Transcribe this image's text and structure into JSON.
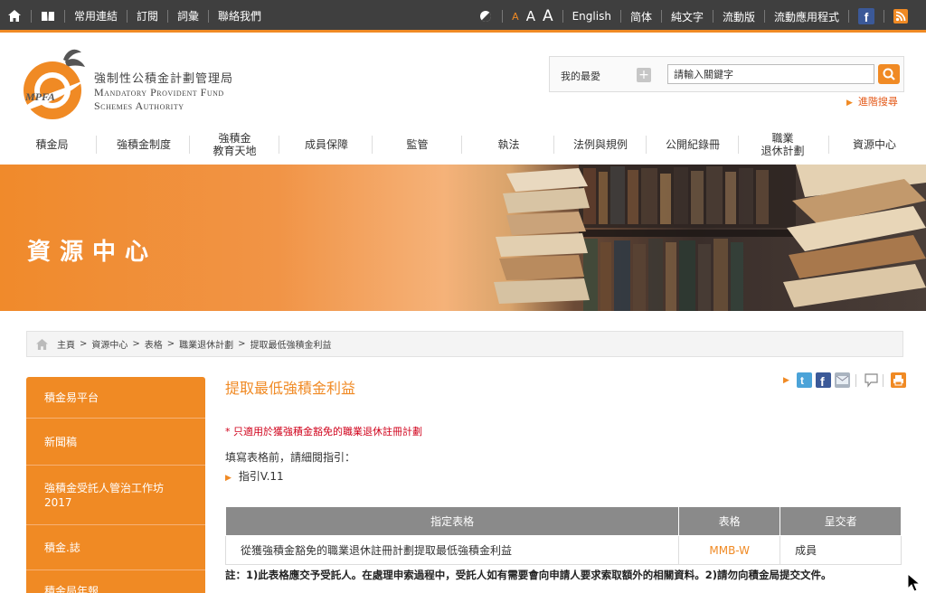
{
  "topbar": {
    "left_links": [
      "常用連結",
      "訂閱",
      "詞彙",
      "聯絡我們"
    ],
    "font_sizes": [
      "A",
      "A",
      "A"
    ],
    "right_links": [
      "English",
      "简体",
      "純文字",
      "流動版",
      "流動應用程式"
    ]
  },
  "logo": {
    "mark": "MPFA",
    "cn": "強制性公積金計劃管理局",
    "en_line1": "Mandatory Provident Fund",
    "en_line2": "Schemes Authority"
  },
  "search": {
    "favorites_label": "我的最愛",
    "input_value": "請輸入關鍵字",
    "advanced_label": "進階搜尋"
  },
  "nav": [
    "積金局",
    "強積金制度",
    "強積金\n教育天地",
    "成員保障",
    "監管",
    "執法",
    "法例與規例",
    "公開紀錄冊",
    "職業\n退休計劃",
    "資源中心"
  ],
  "banner": {
    "title": "資源中心"
  },
  "breadcrumb": [
    "主頁",
    "資源中心",
    "表格",
    "職業退休計劃",
    "提取最低強積金利益"
  ],
  "leftnav": [
    "積金易平台",
    "新聞稿",
    "強積金受託人管治工作坊\n2017",
    "積金.誌",
    "積金局年報"
  ],
  "content": {
    "title": "提取最低強積金利益",
    "note_red": "* 只適用於獲強積金豁免的職業退休註冊計劃",
    "guide_text": "填寫表格前，請細閱指引：",
    "guide_link": "指引V.11",
    "table": {
      "headers": [
        "指定表格",
        "表格",
        "呈交者"
      ],
      "rows": [
        [
          "從獲強積金豁免的職業退休註冊計劃提取最低強積金利益",
          "MMB-W",
          "成員"
        ]
      ]
    },
    "remark": "註：1)此表格應交予受託人。在處理申索過程中，受託人如有需要會向申請人要求索取額外的相關資料。2)請勿向積金局提交文件。"
  },
  "colors": {
    "accent": "#f08a24",
    "topbar": "#3f3f3f",
    "table_header": "#8a8a8a",
    "red_note": "#d0021b"
  }
}
